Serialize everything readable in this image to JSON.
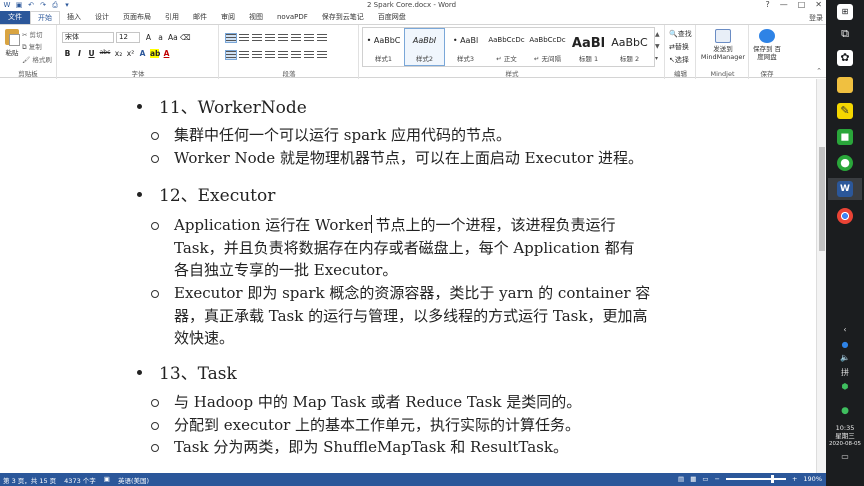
{
  "window": {
    "title": "2 Spark Core.docx - Word",
    "controls": [
      "?",
      "—",
      "□",
      "✕"
    ],
    "login": "登录"
  },
  "tabs": [
    "文件",
    "开始",
    "插入",
    "设计",
    "页面布局",
    "引用",
    "邮件",
    "审阅",
    "视图",
    "novaPDF",
    "保存到云笔记",
    "百度网盘"
  ],
  "ribbon": {
    "clipboard": {
      "label": "剪贴板",
      "paste": "粘贴",
      "cut": "剪切",
      "copy": "复制",
      "format_painter": "格式刷"
    },
    "font": {
      "label": "字体",
      "font_name": "宋体",
      "font_size": "12",
      "row2": [
        "B",
        "I",
        "U",
        "abc",
        "x₂",
        "x²"
      ]
    },
    "paragraph": {
      "label": "段落"
    },
    "styles": {
      "label": "样式",
      "items": [
        {
          "sample": "• AaBbC",
          "name": "样式1",
          "selected": false
        },
        {
          "sample": "AaBbI",
          "name": "样式2",
          "selected": true
        },
        {
          "sample": "• AaBl",
          "name": "样式3",
          "selected": false
        },
        {
          "sample": "AaBbCcDc",
          "name": "↵ 正文",
          "selected": false
        },
        {
          "sample": "AaBbCcDc",
          "name": "↵ 无间隔",
          "selected": false
        },
        {
          "sample": "AaBl",
          "name": "标题 1",
          "selected": false
        },
        {
          "sample": "AaBbC",
          "name": "标题 2",
          "selected": false
        }
      ]
    },
    "editing": {
      "label": "编辑",
      "find": "查找",
      "replace": "替换",
      "select": "选择"
    },
    "mindjet": {
      "label": "Mindjet",
      "button": "发送到 MindManager"
    },
    "save": {
      "label": "保存",
      "button": "保存到 百度网盘"
    }
  },
  "document": {
    "sections": [
      {
        "heading": "11、WorkerNode",
        "items": [
          [
            "集群中任何一个可以运行 spark 应用代码的节点。"
          ],
          [
            "Worker Node 就是物理机器节点，可以在上面启动 Executor 进程。"
          ]
        ]
      },
      {
        "heading": "12、Executor",
        "items": [
          [
            "Application 运行在 Worker 节点上的一个进程，该进程负责运行",
            "Task，并且负责将数据存在内存或者磁盘上，每个 Application 都有",
            "各自独立专享的一批 Executor。"
          ],
          [
            "Executor 即为 spark 概念的资源容器，类比于 yarn 的 container 容",
            "器，真正承载 Task 的运行与管理，以多线程的方式运行 Task，更加高",
            "效快速。"
          ]
        ]
      },
      {
        "heading": "13、Task",
        "items": [
          [
            "与 Hadoop 中的 Map Task 或者 Reduce Task 是类同的。"
          ],
          [
            "分配到 executor 上的基本工作单元，执行实际的计算任务。"
          ],
          [
            "Task 分为两类，即为 ShuffleMapTask 和 ResultTask。"
          ]
        ]
      }
    ]
  },
  "status": {
    "page": "第 3 页，共 15 页",
    "words": "4373 个字",
    "lang": "英语(美国)",
    "zoom": "190%",
    "zoom_fraction": 0.77
  },
  "taskbar": {
    "time": "10:35",
    "weekday": "星期三",
    "date": "2020-08-05",
    "input_method": "拼"
  },
  "colors": {
    "accent": "#2b579a",
    "taskbar": "#1b1d1f"
  }
}
